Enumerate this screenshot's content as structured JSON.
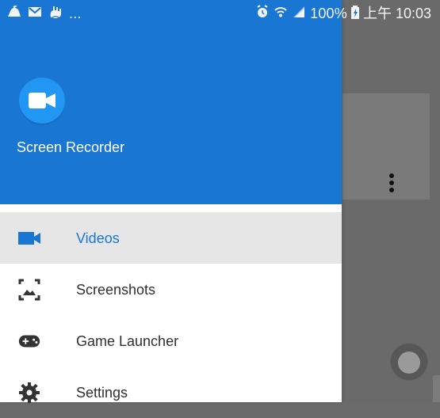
{
  "status_bar": {
    "left_overflow": "...",
    "battery": "100%",
    "time": "上午 10:03"
  },
  "drawer": {
    "app_name": "Screen Recorder",
    "active_item": "videos",
    "items": [
      {
        "id": "videos",
        "label": "Videos",
        "icon": "video-icon"
      },
      {
        "id": "screenshots",
        "label": "Screenshots",
        "icon": "image-frame-icon"
      },
      {
        "id": "game_launcher",
        "label": "Game Launcher",
        "icon": "gamepad-icon"
      },
      {
        "id": "settings",
        "label": "Settings",
        "icon": "gear-icon"
      }
    ]
  },
  "colors": {
    "primary": "#1976d2",
    "logo_circle": "#2196f3",
    "active_row": "#e6e6e6",
    "scrim": "#6a6a6a"
  }
}
